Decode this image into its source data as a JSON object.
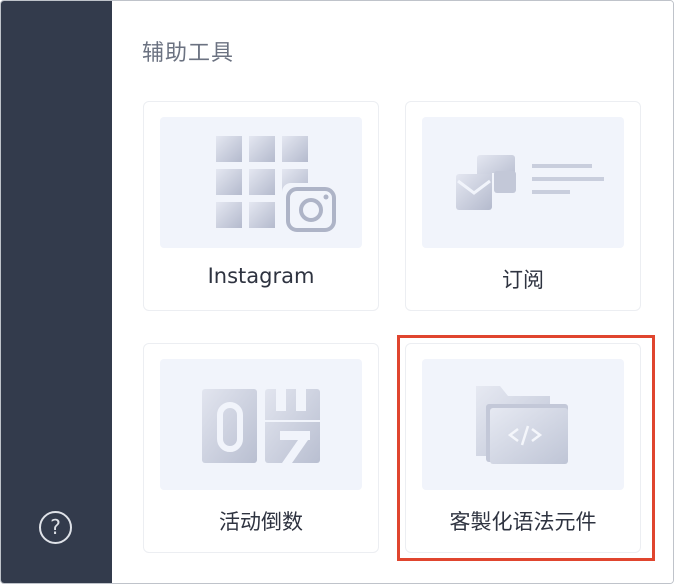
{
  "panel": {
    "title": "辅助工具"
  },
  "sidebar": {
    "help_glyph": "?",
    "help_icon": "help-circle-icon"
  },
  "cards": [
    {
      "label": "Instagram",
      "icon": "instagram-grid-icon"
    },
    {
      "label": "订阅",
      "icon": "subscribe-mail-icon"
    },
    {
      "label": "活动倒数",
      "icon": "countdown-flip-icon"
    },
    {
      "label": "客製化语法元件",
      "icon": "code-folder-icon"
    }
  ],
  "colors": {
    "sidebar": "#333b4c",
    "thumb_bg": "#f1f4fb",
    "highlight": "#e0452e",
    "icon_light": "#e7eaf3",
    "icon_dark": "#b7bdcf"
  }
}
